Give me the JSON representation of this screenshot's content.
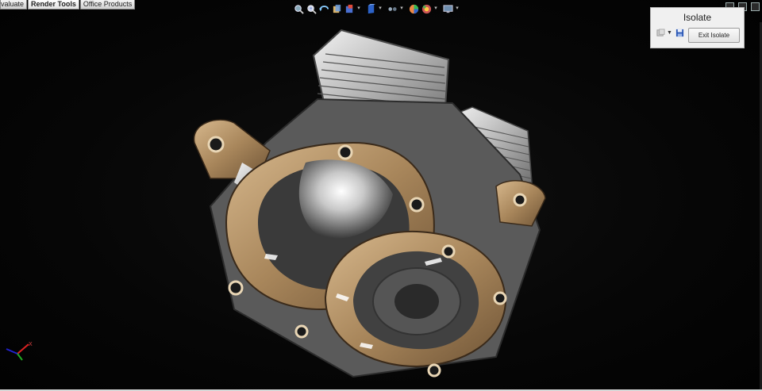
{
  "ribbon": {
    "tabs": [
      {
        "label": "valuate",
        "active": false
      },
      {
        "label": "Render Tools",
        "active": true
      },
      {
        "label": "Office Products",
        "active": false
      }
    ]
  },
  "toolbar": {
    "icons": [
      "zoom-icon",
      "zoom-area-icon",
      "rotate-icon",
      "view-cube-icon",
      "section-view-icon",
      "display-style-icon",
      "hide-show-icon",
      "appearance-icon",
      "scene-icon",
      "monitor-icon"
    ]
  },
  "isolate_panel": {
    "title": "Isolate",
    "exit_label": "Exit Isolate"
  },
  "colors": {
    "background": "#050505",
    "metal": "#cfcfcf",
    "bronze": "#a9865c",
    "panel": "#f0f0f0"
  },
  "model": {
    "name": "engine-crankcase-model"
  }
}
